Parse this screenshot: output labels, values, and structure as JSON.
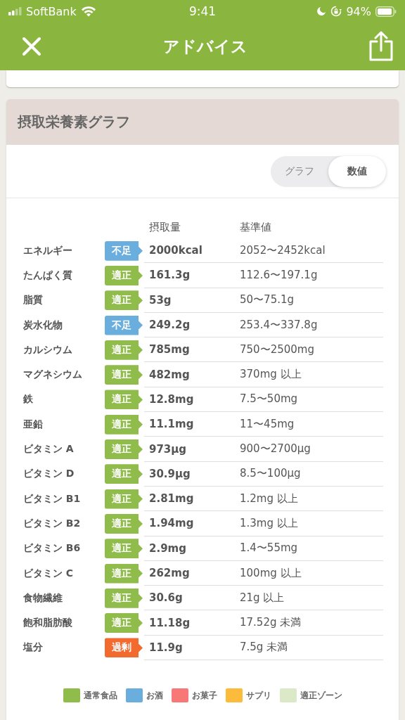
{
  "status_bar": {
    "carrier": "SoftBank",
    "time": "9:41",
    "battery": "94%"
  },
  "nav": {
    "title": "アドバイス"
  },
  "section": {
    "title": "摂取栄養素グラフ",
    "view_toggle": [
      {
        "label": "グラフ",
        "selected": false
      },
      {
        "label": "数値",
        "selected": true
      }
    ],
    "columns": [
      "摂取量",
      "基準値"
    ],
    "rows": [
      {
        "name": "エネルギー",
        "status": {
          "label": "不足",
          "kind": "low"
        },
        "intake": "2000kcal",
        "reference": "2052〜2452kcal"
      },
      {
        "name": "たんぱく質",
        "status": {
          "label": "適正",
          "kind": "ok"
        },
        "intake": "161.3g",
        "reference": "112.6〜197.1g"
      },
      {
        "name": "脂質",
        "status": {
          "label": "適正",
          "kind": "ok"
        },
        "intake": "53g",
        "reference": "50〜75.1g"
      },
      {
        "name": "炭水化物",
        "status": {
          "label": "不足",
          "kind": "low"
        },
        "intake": "249.2g",
        "reference": "253.4〜337.8g"
      },
      {
        "name": "カルシウム",
        "status": {
          "label": "適正",
          "kind": "ok"
        },
        "intake": "785mg",
        "reference": "750〜2500mg"
      },
      {
        "name": "マグネシウム",
        "status": {
          "label": "適正",
          "kind": "ok"
        },
        "intake": "482mg",
        "reference": "370mg 以上"
      },
      {
        "name": "鉄",
        "status": {
          "label": "適正",
          "kind": "ok"
        },
        "intake": "12.8mg",
        "reference": "7.5〜50mg"
      },
      {
        "name": "亜鉛",
        "status": {
          "label": "適正",
          "kind": "ok"
        },
        "intake": "11.1mg",
        "reference": "11〜45mg"
      },
      {
        "name": "ビタミン A",
        "status": {
          "label": "適正",
          "kind": "ok"
        },
        "intake": "973μg",
        "reference": "900〜2700μg"
      },
      {
        "name": "ビタミン D",
        "status": {
          "label": "適正",
          "kind": "ok"
        },
        "intake": "30.9μg",
        "reference": "8.5〜100μg"
      },
      {
        "name": "ビタミン B1",
        "status": {
          "label": "適正",
          "kind": "ok"
        },
        "intake": "2.81mg",
        "reference": "1.2mg 以上"
      },
      {
        "name": "ビタミン B2",
        "status": {
          "label": "適正",
          "kind": "ok"
        },
        "intake": "1.94mg",
        "reference": "1.3mg 以上"
      },
      {
        "name": "ビタミン B6",
        "status": {
          "label": "適正",
          "kind": "ok"
        },
        "intake": "2.9mg",
        "reference": "1.4〜55mg"
      },
      {
        "name": "ビタミン C",
        "status": {
          "label": "適正",
          "kind": "ok"
        },
        "intake": "262mg",
        "reference": "100mg 以上"
      },
      {
        "name": "食物繊維",
        "status": {
          "label": "適正",
          "kind": "ok"
        },
        "intake": "30.6g",
        "reference": "21g 以上"
      },
      {
        "name": "飽和脂肪酸",
        "status": {
          "label": "適正",
          "kind": "ok"
        },
        "intake": "11.18g",
        "reference": "17.52g 未満"
      },
      {
        "name": "塩分",
        "status": {
          "label": "過剰",
          "kind": "over"
        },
        "intake": "11.9g",
        "reference": "7.5g 未満"
      }
    ],
    "legend": [
      {
        "label": "通常食品",
        "color": "#8fbc4a"
      },
      {
        "label": "お酒",
        "color": "#6aaedd"
      },
      {
        "label": "お菓子",
        "color": "#f87878"
      },
      {
        "label": "サプリ",
        "color": "#fdbb3c"
      },
      {
        "label": "適正ゾーン",
        "color": "#dce9c8"
      }
    ]
  }
}
